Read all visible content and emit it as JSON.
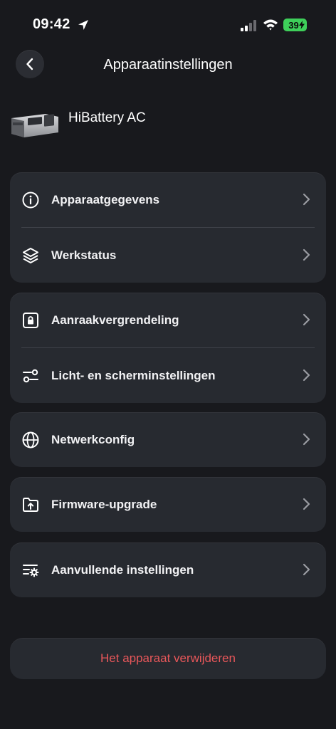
{
  "status_bar": {
    "time": "09:42",
    "battery": "39"
  },
  "header": {
    "title": "Apparaatinstellingen"
  },
  "device": {
    "name": "HiBattery AC"
  },
  "groups": [
    {
      "items": [
        {
          "label": "Apparaatgegevens",
          "icon": "info-icon"
        },
        {
          "label": "Werkstatus",
          "icon": "layers-icon"
        }
      ]
    },
    {
      "items": [
        {
          "label": "Aanraakvergrendeling",
          "icon": "lock-icon"
        },
        {
          "label": "Licht- en scherminstellingen",
          "icon": "sliders-icon"
        }
      ]
    },
    {
      "items": [
        {
          "label": "Netwerkconfig",
          "icon": "globe-icon"
        }
      ]
    },
    {
      "items": [
        {
          "label": "Firmware-upgrade",
          "icon": "folder-upload-icon"
        }
      ]
    },
    {
      "items": [
        {
          "label": "Aanvullende instellingen",
          "icon": "settings-list-icon"
        }
      ]
    }
  ],
  "delete_button": {
    "label": "Het apparaat verwijderen"
  },
  "colors": {
    "background": "#18191d",
    "card": "#272a30",
    "danger": "#e8575a",
    "battery": "#3ecf5a"
  }
}
